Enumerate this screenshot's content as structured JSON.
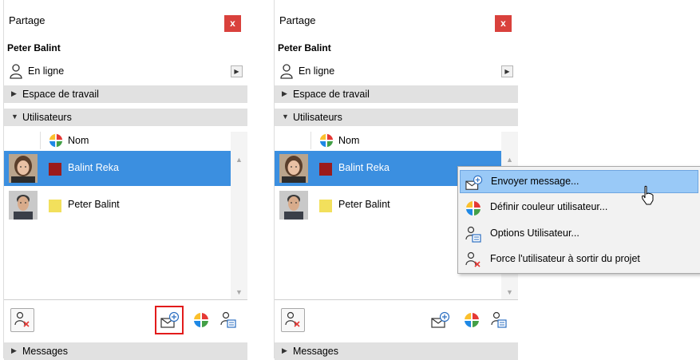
{
  "panels": [
    {
      "title": "Partage",
      "close_label": "x",
      "user_name": "Peter Balint",
      "status": "En ligne",
      "sections": {
        "workspace": "Espace de travail",
        "users": "Utilisateurs",
        "messages": "Messages"
      },
      "column_header": "Nom",
      "users": [
        {
          "name": "Balint Reka",
          "color": "#9b1b1b",
          "selected": true
        },
        {
          "name": "Peter Balint",
          "color": "#f2e05c",
          "selected": false
        }
      ]
    },
    {
      "title": "Partage",
      "close_label": "x",
      "user_name": "Peter Balint",
      "status": "En ligne",
      "sections": {
        "workspace": "Espace de travail",
        "users": "Utilisateurs",
        "messages": "Messages"
      },
      "column_header": "Nom",
      "users": [
        {
          "name": "Balint Reka",
          "color": "#9b1b1b",
          "selected": true
        },
        {
          "name": "Peter Balint",
          "color": "#f2e05c",
          "selected": false
        }
      ]
    }
  ],
  "context_menu": {
    "items": [
      {
        "label": "Envoyer message...",
        "icon": "send-message-icon",
        "hovered": true
      },
      {
        "label": "Définir couleur utilisateur...",
        "icon": "color-wheel-icon",
        "hovered": false
      },
      {
        "label": "Options Utilisateur...",
        "icon": "user-options-icon",
        "hovered": false
      },
      {
        "label": "Force l'utilisateur à sortir du projet",
        "icon": "kick-user-icon",
        "hovered": false
      }
    ]
  },
  "colors": {
    "selection": "#3b8fe0",
    "menu_hover": "#99c9f7",
    "close_button": "#d9413c",
    "highlight_box": "#e21b1b"
  }
}
